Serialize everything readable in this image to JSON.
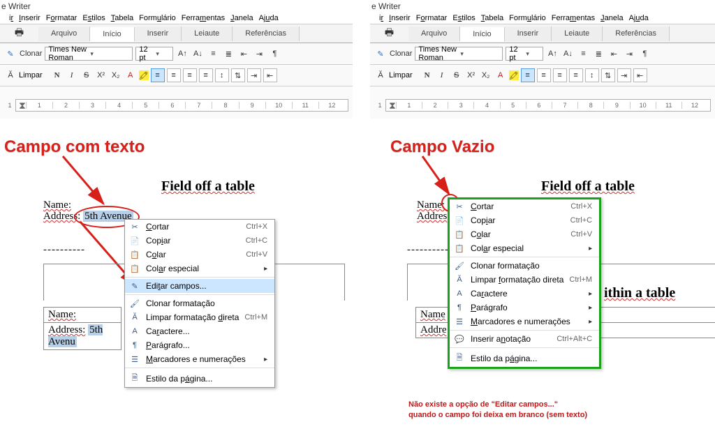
{
  "title_suffix": "e Writer",
  "menus": [
    "ir",
    "Inserir",
    "Formatar",
    "Estilos",
    "Tabela",
    "Formulário",
    "Ferramentas",
    "Janela",
    "Ajuda"
  ],
  "menus_u": [
    "i",
    "I",
    "F",
    "E",
    "T",
    "F",
    "F",
    "J",
    "A"
  ],
  "tabs": {
    "arquivo": "Arquivo",
    "inicio": "Início",
    "inserir": "Inserir",
    "leiaute": "Leiaute",
    "referencias": "Referências"
  },
  "tb": {
    "clonar": "Clonar",
    "limpar": "Limpar",
    "font": "Times New Roman",
    "size": "12 pt",
    "B": "N",
    "I": "I",
    "U": "S"
  },
  "doc": {
    "heading_off": "Field off a table",
    "name_label": "Name:",
    "address_label": "Address:",
    "address_value": "5th Avenue",
    "dashes": "----------",
    "heading_within": "within a table",
    "heading_ithin": "ithin a table",
    "address_partial": "5th Avenu"
  },
  "ctx": {
    "cortar": "Cortar",
    "sc_cortar": "Ctrl+X",
    "copiar": "Copiar",
    "sc_copiar": "Ctrl+C",
    "colar": "Colar",
    "sc_colar": "Ctrl+V",
    "colar_esp": "Colar especial",
    "editar": "Editar campos...",
    "clonar_fmt": "Clonar formatação",
    "limpar_fmt": "Limpar formatação direta",
    "sc_limpar": "Ctrl+M",
    "caractere": "Caractere...",
    "paragrafo": "Parágrafo...",
    "marcadores": "Marcadores e numerações",
    "anotacao": "Inserir anotação",
    "sc_anot": "Ctrl+Alt+C",
    "estilo": "Estilo da página..."
  },
  "callout_left": "Campo com texto",
  "callout_right": "Campo Vazio",
  "red1": "Não existe a opção de \"Editar campos...\"",
  "red2": "quando o campo foi deixa em branco (sem texto)"
}
